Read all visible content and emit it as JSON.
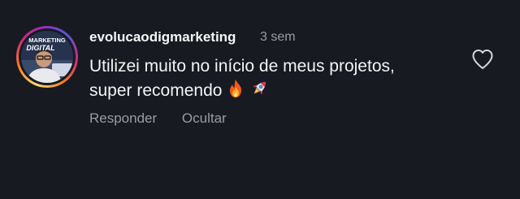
{
  "comment": {
    "username": "evolucaodigmarketing",
    "time": "3 sem",
    "text_line1": "Utilizei muito no início de meus projetos,",
    "text_line2": "super recomendo",
    "emojis": [
      "fire",
      "rocket"
    ],
    "avatar_text": [
      "MARKETING",
      "DIGITAL"
    ],
    "actions": {
      "reply_label": "Responder",
      "hide_label": "Ocultar"
    },
    "like_icon": "heart-outline-icon"
  },
  "colors": {
    "background": "#181a22",
    "text_primary": "#f4f4f4",
    "text_secondary": "#9a9ca4"
  }
}
